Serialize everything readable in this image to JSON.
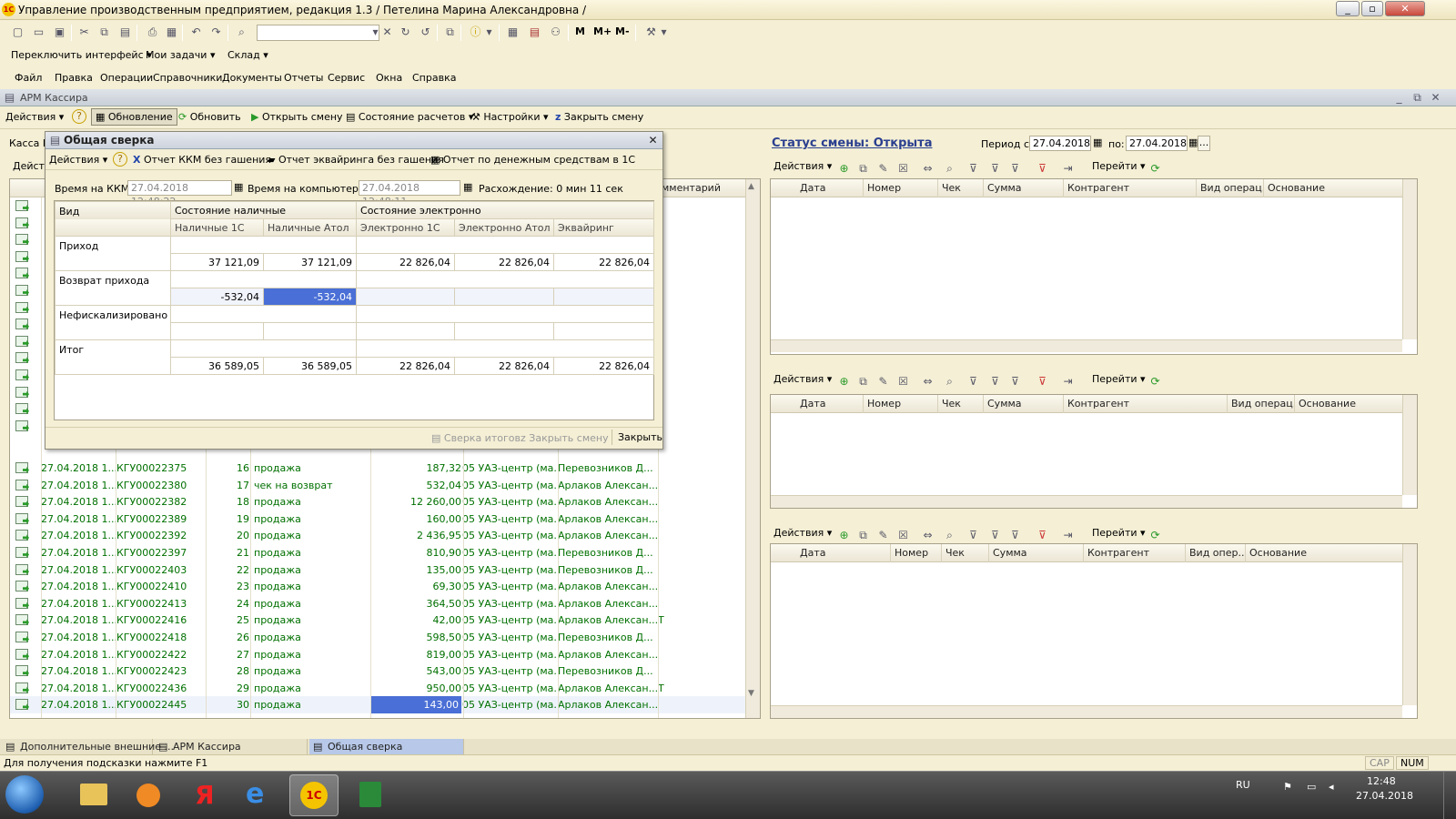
{
  "window": {
    "title": "Управление производственным предприятием, редакция 1.3 / Петелина Марина Александровна /",
    "app_icon": "1C"
  },
  "toolbar": {
    "m_label": "M",
    "mplus_label": "M+",
    "mminus_label": "M-"
  },
  "interface_row": {
    "switch_interface": "Переключить интерфейс",
    "my_tasks": "Мои задачи",
    "warehouse": "Склад"
  },
  "menu": [
    "Файл",
    "Правка",
    "Операции",
    "Справочники",
    "Документы",
    "Отчеты",
    "Сервис",
    "Окна",
    "Справка"
  ],
  "arm": {
    "title": "АРМ Кассира",
    "actions": "Действия",
    "help": "?",
    "update_mode": "Обновление",
    "refresh": "Обновить",
    "open_shift": "Открыть смену",
    "settlements_state": "Состояние расчетов",
    "settings": "Настройки",
    "close_shift": "Закрыть смену",
    "kassa_label": "Касса К",
    "actions_left": "Дейст",
    "comment_header": "мментарий"
  },
  "status": {
    "shift_status": "Статус смены: Открыта",
    "period_from_label": "Период с:",
    "period_from": "27.04.2018",
    "period_to_label": "по:",
    "period_to": "27.04.2018"
  },
  "right_grids": {
    "actions": "Действия",
    "goto": "Перейти",
    "headers1": [
      "Дата",
      "Номер",
      "Чек",
      "Сумма",
      "Контрагент",
      "Вид операц...",
      "Основание"
    ],
    "headers2": [
      "Дата",
      "Номер",
      "Чек",
      "Сумма",
      "Контрагент",
      "Вид операц...",
      "Основание"
    ],
    "headers3": [
      "Дата",
      "Номер",
      "Чек",
      "Сумма",
      "Контрагент",
      "Вид опер...",
      "Основание"
    ]
  },
  "docs": [
    {
      "date": "27.04.2018 1...",
      "num": "КГУ00022375",
      "check": "16",
      "op": "продажа",
      "sum": "187,32",
      "contr": "05 УАЗ-центр (ма...",
      "author": "Перевозников Д...",
      "extra": ""
    },
    {
      "date": "27.04.2018 1...",
      "num": "КГУ00022380",
      "check": "17",
      "op": "чек на возврат",
      "sum": "532,04",
      "contr": "05 УАЗ-центр (ма...",
      "author": "Арлаков Алексан...",
      "extra": ""
    },
    {
      "date": "27.04.2018 1...",
      "num": "КГУ00022382",
      "check": "18",
      "op": "продажа",
      "sum": "12 260,00",
      "contr": "05 УАЗ-центр (ма...",
      "author": "Арлаков Алексан...",
      "extra": ""
    },
    {
      "date": "27.04.2018 1...",
      "num": "КГУ00022389",
      "check": "19",
      "op": "продажа",
      "sum": "160,00",
      "contr": "05 УАЗ-центр (ма...",
      "author": "Арлаков Алексан...",
      "extra": ""
    },
    {
      "date": "27.04.2018 1...",
      "num": "КГУ00022392",
      "check": "20",
      "op": "продажа",
      "sum": "2 436,95",
      "contr": "05 УАЗ-центр (ма...",
      "author": "Арлаков Алексан...",
      "extra": ""
    },
    {
      "date": "27.04.2018 1...",
      "num": "КГУ00022397",
      "check": "21",
      "op": "продажа",
      "sum": "810,90",
      "contr": "05 УАЗ-центр (ма...",
      "author": "Перевозников Д...",
      "extra": ""
    },
    {
      "date": "27.04.2018 1...",
      "num": "КГУ00022403",
      "check": "22",
      "op": "продажа",
      "sum": "135,00",
      "contr": "05 УАЗ-центр (ма...",
      "author": "Перевозников Д...",
      "extra": ""
    },
    {
      "date": "27.04.2018 1...",
      "num": "КГУ00022410",
      "check": "23",
      "op": "продажа",
      "sum": "69,30",
      "contr": "05 УАЗ-центр (ма...",
      "author": "Арлаков Алексан...",
      "extra": ""
    },
    {
      "date": "27.04.2018 1...",
      "num": "КГУ00022413",
      "check": "24",
      "op": "продажа",
      "sum": "364,50",
      "contr": "05 УАЗ-центр (ма...",
      "author": "Арлаков Алексан...",
      "extra": ""
    },
    {
      "date": "27.04.2018 1...",
      "num": "КГУ00022416",
      "check": "25",
      "op": "продажа",
      "sum": "42,00",
      "contr": "05 УАЗ-центр (ма...",
      "author": "Арлаков Алексан...",
      "extra": "Т"
    },
    {
      "date": "27.04.2018 1...",
      "num": "КГУ00022418",
      "check": "26",
      "op": "продажа",
      "sum": "598,50",
      "contr": "05 УАЗ-центр (ма...",
      "author": "Перевозников Д...",
      "extra": ""
    },
    {
      "date": "27.04.2018 1...",
      "num": "КГУ00022422",
      "check": "27",
      "op": "продажа",
      "sum": "819,00",
      "contr": "05 УАЗ-центр (ма...",
      "author": "Арлаков Алексан...",
      "extra": ""
    },
    {
      "date": "27.04.2018 1...",
      "num": "КГУ00022423",
      "check": "28",
      "op": "продажа",
      "sum": "543,00",
      "contr": "05 УАЗ-центр (ма...",
      "author": "Перевозников Д...",
      "extra": ""
    },
    {
      "date": "27.04.2018 1...",
      "num": "КГУ00022436",
      "check": "29",
      "op": "продажа",
      "sum": "950,00",
      "contr": "05 УАЗ-центр (ма...",
      "author": "Арлаков Алексан...",
      "extra": "Т"
    },
    {
      "date": "27.04.2018 1...",
      "num": "КГУ00022445",
      "check": "30",
      "op": "продажа",
      "sum": "143,00",
      "contr": "05 УАЗ-центр (ма...",
      "author": "Арлаков Алексан...",
      "extra": ""
    }
  ],
  "dialog": {
    "title": "Общая сверка",
    "actions": "Действия",
    "kkm_report": "Отчет ККМ без гашения",
    "acquiring_report": "Отчет эквайринга без гашения",
    "money_report": "Отчет по денежным средствам в 1С",
    "kkm_time_label": "Время на ККМ:",
    "kkm_time": "27.04.2018 12:48:22",
    "pc_time_label": "Время на компьютере:",
    "pc_time": "27.04.2018 12:48:11",
    "diff": "Расхождение: 0 мин 11 сек",
    "col_kind": "Вид",
    "group_cash": "Состояние наличные",
    "group_electronic": "Состояние электронно",
    "cols": [
      "Наличные 1С",
      "Наличные Атол",
      "Электронно 1С",
      "Электронно Атол",
      "Эквайринг"
    ],
    "rows": [
      {
        "label": "Приход",
        "values": [
          "37 121,09",
          "37 121,09",
          "22 826,04",
          "22 826,04",
          "22 826,04"
        ]
      },
      {
        "label": "Возврат прихода",
        "values": [
          "-532,04",
          "-532,04",
          "",
          "",
          ""
        ]
      },
      {
        "label": "Нефискализировано",
        "values": [
          "",
          "",
          "",
          "",
          ""
        ]
      },
      {
        "label": "Итог",
        "values": [
          "36 589,05",
          "36 589,05",
          "22 826,04",
          "22 826,04",
          "22 826,04"
        ]
      }
    ],
    "reconcile_btn": "Сверка итогов",
    "close_shift_btn": "Закрыть смену",
    "close_btn": "Закрыть"
  },
  "window_tabs": [
    "Дополнительные внешние ...",
    "АРМ Кассира",
    "Общая сверка"
  ],
  "statusbar": {
    "hint": "Для получения подсказки нажмите F1",
    "cap": "CAP",
    "num": "NUM"
  },
  "tray": {
    "lang": "RU",
    "time": "12:48",
    "date": "27.04.2018"
  },
  "colors": {
    "highlight": "#4a6fd6",
    "green_text": "#007000"
  }
}
